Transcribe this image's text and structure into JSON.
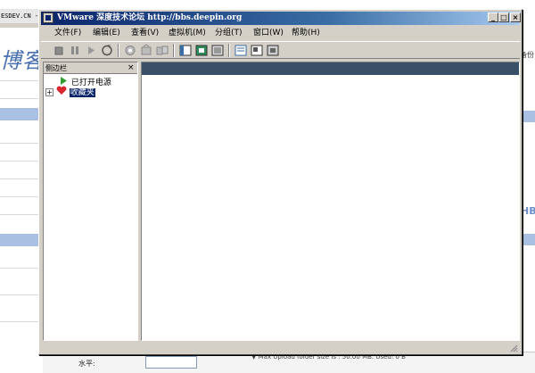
{
  "background_page": {
    "tab_text": "ESDEV.CN -",
    "blog_mark": "博客",
    "right_backup": "备份",
    "right_logo": "HB",
    "level_label": "水平:",
    "upload_note": "▼ Max Upload folder size is : 50.00 MB. Used: 0 B"
  },
  "window": {
    "title": "VMware 深度技术论坛  http://bbs.deepin.org",
    "buttons": {
      "minimize": "_",
      "maximize": "□",
      "close": "×"
    }
  },
  "menu": {
    "file": "文件(F)",
    "edit": "编辑(E)",
    "view": "查看(V)",
    "vm": "虚拟机(M)",
    "group": "分组(T)",
    "window": "窗口(W)",
    "help": "帮助(H)"
  },
  "toolbar": {
    "icons": [
      "stop-icon",
      "pause-icon",
      "play-icon",
      "reset-icon",
      "snapshot-icon",
      "revert-icon",
      "manage-snapshots-icon",
      "show-sidebar-icon",
      "fullscreen-icon",
      "quick-switch-icon",
      "summary-view-icon",
      "console-view-icon",
      "appliance-view-icon"
    ]
  },
  "sidebar": {
    "title": "侧边栏",
    "close": "×",
    "items": [
      {
        "label": "已打开电源",
        "icon": "play-icon"
      },
      {
        "label": "收藏夹",
        "icon": "heart-icon",
        "expander": "+"
      }
    ]
  },
  "colors": {
    "titlebar_start": "#0a246a",
    "titlebar_end": "#a6caf0",
    "window_face": "#d4d0c8",
    "main_header": "#3a4f68",
    "selection": "#0a246a"
  }
}
